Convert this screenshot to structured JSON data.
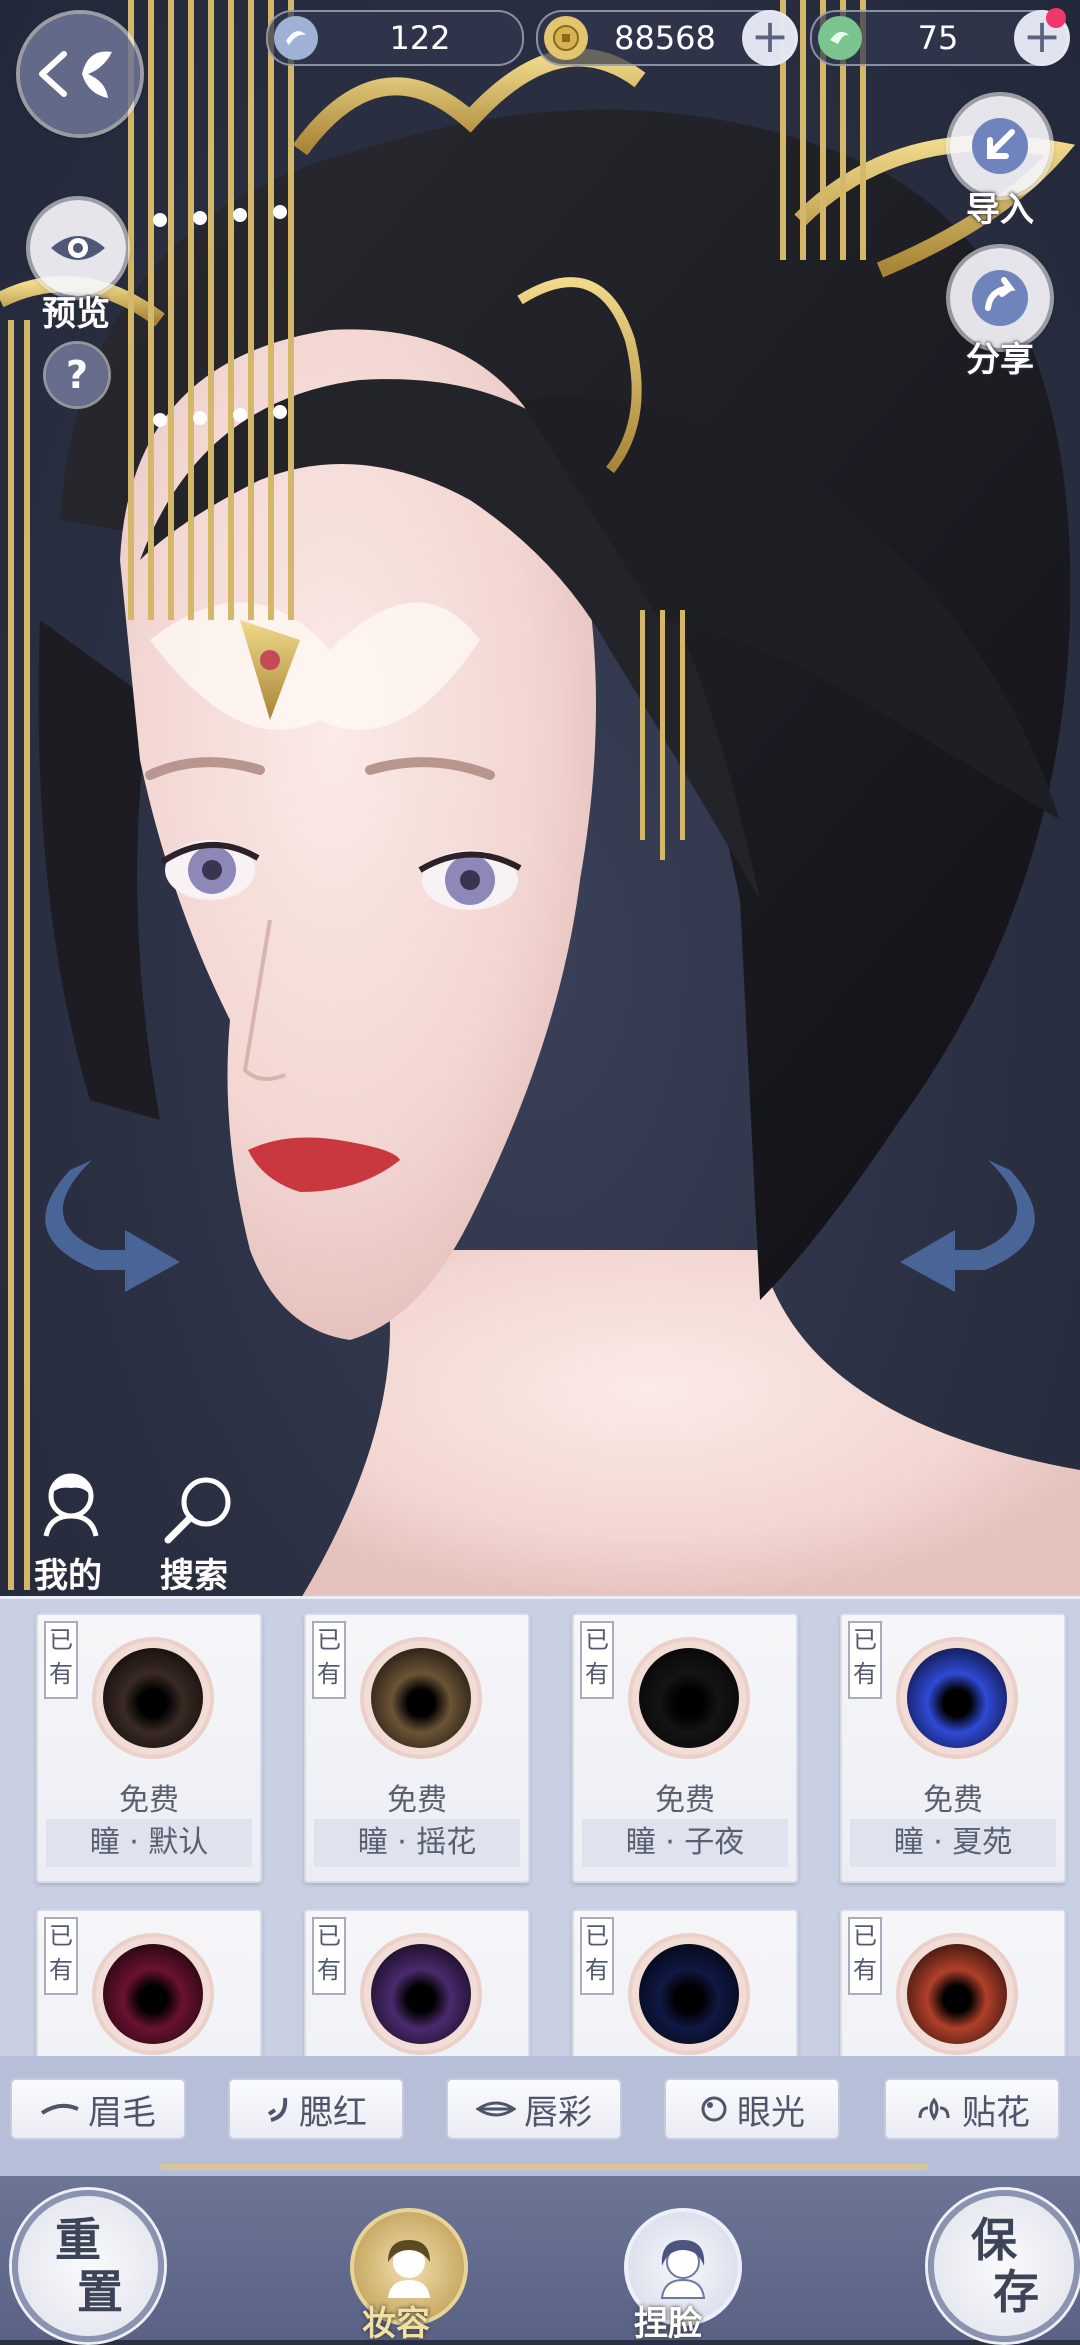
{
  "currencies": [
    {
      "name": "silver",
      "value": "122",
      "icon": "silver-coin-icon"
    },
    {
      "name": "gold",
      "value": "88568",
      "icon": "copper-coin-icon"
    },
    {
      "name": "jade",
      "value": "75",
      "icon": "jade-icon"
    }
  ],
  "side_buttons": {
    "preview": "预览",
    "import": "导入",
    "share": "分享",
    "help": "?",
    "mine": "我的",
    "search": "搜索"
  },
  "items": [
    {
      "owned": "已有",
      "price": "免费",
      "name": "瞳 · 默认",
      "color": "#3a2a24"
    },
    {
      "owned": "已有",
      "price": "免费",
      "name": "瞳 · 摇花",
      "color": "#6b5436"
    },
    {
      "owned": "已有",
      "price": "免费",
      "name": "瞳 · 子夜",
      "color": "#141414"
    },
    {
      "owned": "已有",
      "price": "免费",
      "name": "瞳 · 夏苑",
      "color": "#2f4ad6"
    },
    {
      "owned": "已有",
      "price": "",
      "name": "",
      "color": "#6a1230"
    },
    {
      "owned": "已有",
      "price": "",
      "name": "",
      "color": "#4a2a6e"
    },
    {
      "owned": "已有",
      "price": "",
      "name": "",
      "color": "#101844"
    },
    {
      "owned": "已有",
      "price": "",
      "name": "",
      "color": "#b0402a"
    }
  ],
  "tabs": [
    {
      "label": "眉毛",
      "icon": "brow-icon"
    },
    {
      "label": "腮红",
      "icon": "blush-icon"
    },
    {
      "label": "唇彩",
      "icon": "lips-icon"
    },
    {
      "label": "眼光",
      "icon": "eye-light-icon"
    },
    {
      "label": "贴花",
      "icon": "decal-icon"
    }
  ],
  "bottom": {
    "reset_top": "重",
    "reset_bottom": "置",
    "makeup": "妆容",
    "face": "捏脸",
    "save_top": "保",
    "save_bottom": "存"
  }
}
